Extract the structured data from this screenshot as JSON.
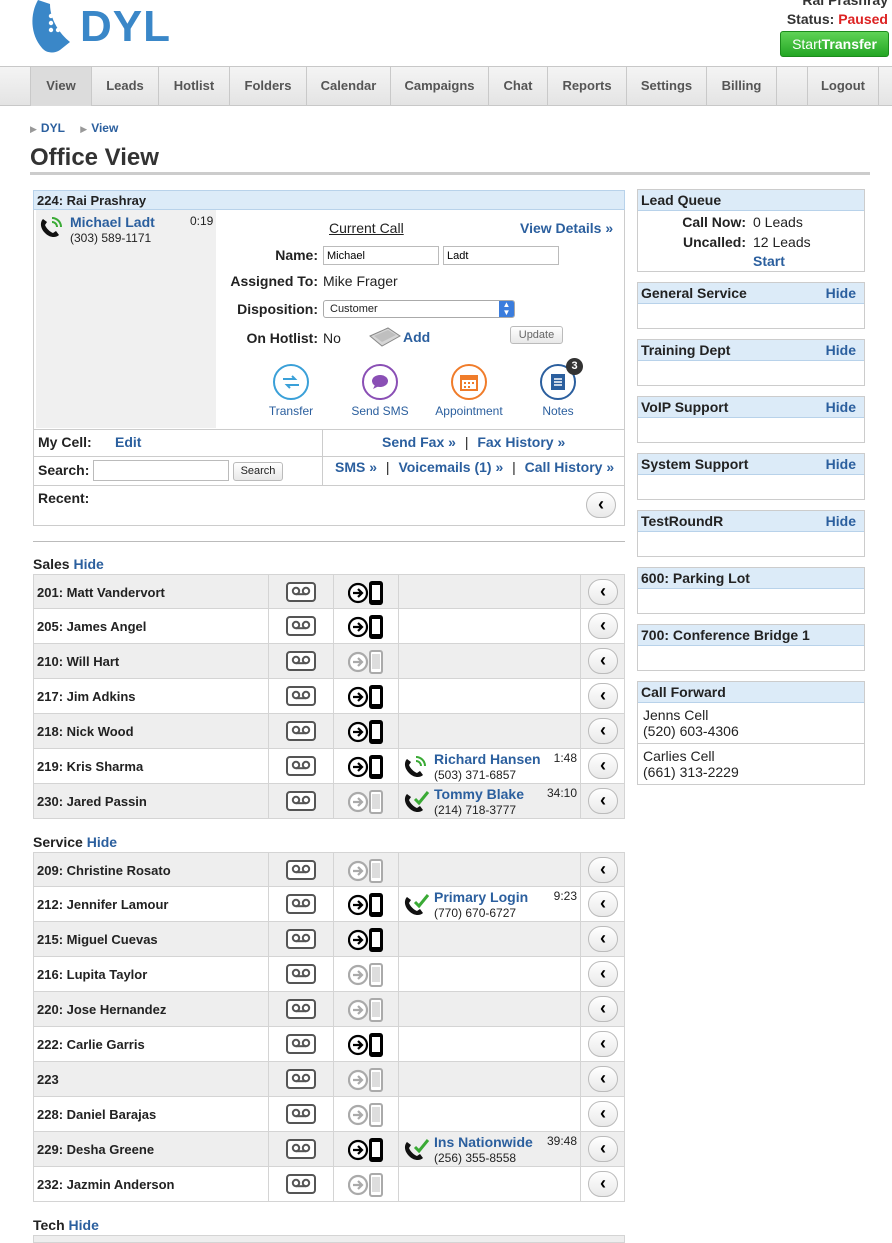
{
  "header": {
    "logo_text": "DYL",
    "user_name": "Rai Prashray",
    "status_label": "Status:",
    "status_value": "Paused",
    "start_transfer_a": "Start",
    "start_transfer_b": "Transfer"
  },
  "nav": [
    "View",
    "Leads",
    "Hotlist",
    "Folders",
    "Calendar",
    "Campaigns",
    "Chat",
    "Reports",
    "Settings",
    "Billing",
    "",
    "Logout"
  ],
  "breadcrumb": [
    "DYL",
    "View"
  ],
  "page_title": "Office View",
  "main": {
    "panel_title": "224: Rai Prashray",
    "caller": {
      "name": "Michael Ladt",
      "phone": "(303) 589-1171",
      "time": "0:19"
    },
    "current_call_label": "Current Call",
    "view_details": "View Details »",
    "name_label": "Name:",
    "first_name": "Michael",
    "last_name": "Ladt",
    "assigned_label": "Assigned To:",
    "assigned_value": "Mike Frager",
    "disposition_label": "Disposition:",
    "disposition_value": "Customer",
    "hotlist_label": "On Hotlist:",
    "hotlist_value": "No",
    "add_label": "Add",
    "update_label": "Update",
    "actions": [
      {
        "label": "Transfer",
        "icon": "transfer-icon",
        "color": "#3aa0d8"
      },
      {
        "label": "Send SMS",
        "icon": "sms-icon",
        "color": "#8a4fb5"
      },
      {
        "label": "Appointment",
        "icon": "calendar-icon",
        "color": "#f07c2a"
      },
      {
        "label": "Notes",
        "icon": "notes-icon",
        "color": "#2b5f9e",
        "badge": "3"
      }
    ],
    "my_cell_label": "My Cell:",
    "edit_label": "Edit",
    "send_fax": "Send Fax »",
    "fax_history": "Fax History »",
    "search_label": "Search:",
    "search_button": "Search",
    "sms": "SMS »",
    "voicemails": "Voicemails (1) »",
    "call_history": "Call History »",
    "recent_label": "Recent:",
    "sep": "|"
  },
  "groups": [
    {
      "title": "Sales",
      "hide": "Hide",
      "rows": [
        {
          "ext": "201: Matt Vandervort",
          "active": true
        },
        {
          "ext": "205: James Angel",
          "active": true
        },
        {
          "ext": "210: Will Hart",
          "active": false
        },
        {
          "ext": "217: Jim Adkins",
          "active": true
        },
        {
          "ext": "218: Nick Wood",
          "active": true
        },
        {
          "ext": "219: Kris Sharma",
          "active": true,
          "call": {
            "name": "Richard Hansen",
            "phone": "(503) 371-6857",
            "time": "1:48",
            "connected": false
          }
        },
        {
          "ext": "230: Jared Passin",
          "active": false,
          "call": {
            "name": "Tommy Blake",
            "phone": "(214) 718-3777",
            "time": "34:10",
            "connected": true
          }
        }
      ]
    },
    {
      "title": "Service",
      "hide": "Hide",
      "rows": [
        {
          "ext": "209: Christine Rosato",
          "active": false
        },
        {
          "ext": "212: Jennifer Lamour",
          "active": true,
          "call": {
            "name": "Primary Login",
            "phone": "(770) 670-6727",
            "time": "9:23",
            "connected": true
          }
        },
        {
          "ext": "215: Miguel Cuevas",
          "active": true
        },
        {
          "ext": "216: Lupita Taylor",
          "active": false
        },
        {
          "ext": "220: Jose Hernandez",
          "active": false
        },
        {
          "ext": "222: Carlie Garris",
          "active": true
        },
        {
          "ext": "223",
          "active": false
        },
        {
          "ext": "228: Daniel Barajas",
          "active": false
        },
        {
          "ext": "229: Desha Greene",
          "active": true,
          "call": {
            "name": "Ins Nationwide",
            "phone": "(256) 355-8558",
            "time": "39:48",
            "connected": true
          }
        },
        {
          "ext": "232: Jazmin Anderson",
          "active": false
        }
      ]
    },
    {
      "title": "Tech",
      "hide": "Hide",
      "rows": []
    }
  ],
  "right": {
    "lead_queue": {
      "title": "Lead Queue",
      "call_now_label": "Call Now:",
      "call_now_value": "0 Leads",
      "uncalled_label": "Uncalled:",
      "uncalled_value": "12 Leads",
      "start": "Start"
    },
    "boxes": [
      {
        "title": "General Service",
        "hide": "Hide"
      },
      {
        "title": "Training Dept",
        "hide": "Hide"
      },
      {
        "title": "VoIP Support",
        "hide": "Hide"
      },
      {
        "title": "System Support",
        "hide": "Hide"
      },
      {
        "title": "TestRoundR",
        "hide": "Hide"
      },
      {
        "title": "600: Parking Lot",
        "hide": ""
      },
      {
        "title": "700: Conference Bridge 1",
        "hide": ""
      }
    ],
    "call_forward": {
      "title": "Call Forward",
      "entries": [
        {
          "name": "Jenns Cell",
          "phone": "(520) 603-4306"
        },
        {
          "name": "Carlies Cell",
          "phone": "(661) 313-2229"
        }
      ]
    }
  },
  "colors": {
    "accent": "#2b5f9e",
    "panel_head": "#dcebf8",
    "paused": "#dd2222",
    "start_green": "#33b533"
  }
}
